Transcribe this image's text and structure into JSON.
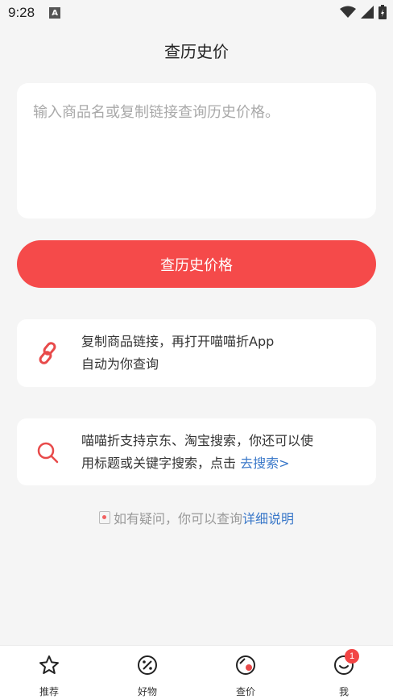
{
  "status_bar": {
    "time": "9:28",
    "a_label": "A"
  },
  "header": {
    "title": "查历史价"
  },
  "search": {
    "placeholder": "输入商品名或复制链接查询历史价格。",
    "value": ""
  },
  "query_button": {
    "label": "查历史价格"
  },
  "tips": [
    {
      "icon": "link-icon",
      "line1": "复制商品链接，再打开喵喵折App",
      "line2": "自动为你查询"
    },
    {
      "icon": "search-icon",
      "line1": "喵喵折支持京东、淘宝搜索，你还可以使",
      "line2": "用标题或关键字搜索，点击 ",
      "link": "去搜索>"
    }
  ],
  "help": {
    "text": "如有疑问，你可以查询 ",
    "link": "详细说明"
  },
  "tabs": [
    {
      "label": "推荐",
      "icon": "star-icon"
    },
    {
      "label": "好物",
      "icon": "discount-icon"
    },
    {
      "label": "查价",
      "icon": "price-check-icon"
    },
    {
      "label": "我",
      "icon": "smile-icon",
      "badge": "1"
    }
  ],
  "colors": {
    "accent": "#f54a4a",
    "link": "#3a78c9",
    "background": "#f5f5f5"
  }
}
